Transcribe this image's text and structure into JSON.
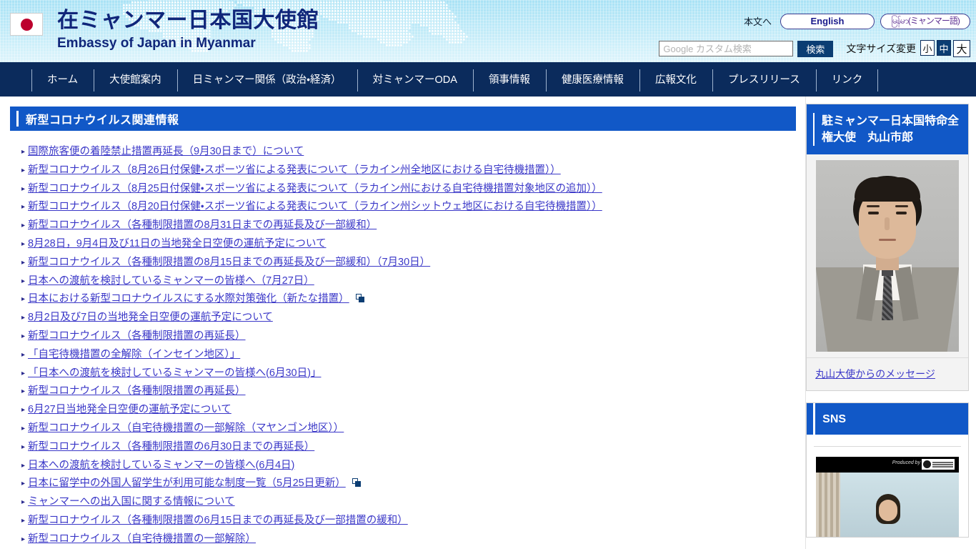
{
  "site": {
    "title_jp": "在ミャンマー日本国大使館",
    "title_en": "Embassy of Japan in Myanmar",
    "flag_icon": "japan-flag-icon"
  },
  "header": {
    "skip_link": "本文へ",
    "lang_english": "English",
    "lang_myanmar": "မြန်မာ(ミャンマー語)",
    "search": {
      "placeholder": "Google カスタム検索",
      "value": "",
      "button": "検索"
    },
    "fontsize": {
      "label": "文字サイズ変更",
      "options": [
        "小",
        "中",
        "大"
      ],
      "selected": "中"
    }
  },
  "nav": {
    "items": [
      {
        "label": "ホーム"
      },
      {
        "label": "大使館案内"
      },
      {
        "label": "日ミャンマー関係（政治・経済）"
      },
      {
        "label": "対ミャンマーODA"
      },
      {
        "label": "領事情報"
      },
      {
        "label": "健康医療情報"
      },
      {
        "label": "広報文化"
      },
      {
        "label": "プレスリリース"
      },
      {
        "label": "リンク"
      }
    ]
  },
  "main": {
    "section_title": "新型コロナウイルス関連情報",
    "links": [
      {
        "label": "国際旅客便の着陸禁止措置再延長（9月30日まで）について",
        "external": false
      },
      {
        "label": "新型コロナウイルス（8月26日付保健・スポーツ省による発表について（ラカイン州全地区における自宅待機措置））",
        "external": false
      },
      {
        "label": "新型コロナウイルス（8月25日付保健・スポーツ省による発表について（ラカイン州における自宅待機措置対象地区の追加））",
        "external": false
      },
      {
        "label": "新型コロナウイルス（8月20日付保健・スポーツ省による発表について（ラカイン州シットウェ地区における自宅待機措置））",
        "external": false
      },
      {
        "label": "新型コロナウイルス（各種制限措置の8月31日までの再延長及び一部緩和）",
        "external": false
      },
      {
        "label": "8月28日，9月4日及び11日の当地発全日空便の運航予定について",
        "external": false
      },
      {
        "label": "新型コロナウイルス（各種制限措置の8月15日までの再延長及び一部緩和）（7月30日）",
        "external": false
      },
      {
        "label": "日本への渡航を検討しているミャンマーの皆様へ（7月27日）",
        "external": false
      },
      {
        "label": "日本における新型コロナウイルスにする水際対策強化（新たな措置）",
        "external": true
      },
      {
        "label": "8月2日及び7日の当地発全日空便の運航予定について",
        "external": false
      },
      {
        "label": "新型コロナウイルス（各種制限措置の再延長）",
        "external": false
      },
      {
        "label": "「自宅待機措置の全解除（インセイン地区）」",
        "external": false
      },
      {
        "label": "「日本への渡航を検討しているミャンマーの皆様へ(6月30日)」",
        "external": false
      },
      {
        "label": "新型コロナウイルス（各種制限措置の再延長）",
        "external": false
      },
      {
        "label": "6月27日当地発全日空便の運航予定について",
        "external": false
      },
      {
        "label": "新型コロナウイルス（自宅待機措置の一部解除（マヤンゴン地区））",
        "external": false
      },
      {
        "label": "新型コロナウイルス（各種制限措置の6月30日までの再延長）",
        "external": false
      },
      {
        "label": "日本への渡航を検討しているミャンマーの皆様へ(6月4日)",
        "external": false
      },
      {
        "label": "日本に留学中の外国人留学生が利用可能な制度一覧（5月25日更新）",
        "external": true
      },
      {
        "label": "ミャンマーへの出入国に関する情報について",
        "external": false
      },
      {
        "label": "新型コロナウイルス（各種制限措置の6月15日までの再延長及び一部措置の緩和）",
        "external": false
      },
      {
        "label": "新型コロナウイルス（自宅待機措置の一部解除）",
        "external": false
      }
    ]
  },
  "sidebar": {
    "ambassador": {
      "heading": "駐ミャンマー日本国特命全権大使　丸山市郎",
      "photo_alt": "ambassador-portrait",
      "message_link": "丸山大使からのメッセージ"
    },
    "sns": {
      "heading": "SNS",
      "video_producer": "Produced by",
      "video_thumb_alt": "sns-video-thumbnail"
    }
  },
  "colors": {
    "nav_navy": "#0b2b5c",
    "heading_blue": "#1158c7",
    "link_purple": "#3b38c8",
    "header_sky": "#bfeaf8",
    "flag_red": "#bc002d"
  }
}
